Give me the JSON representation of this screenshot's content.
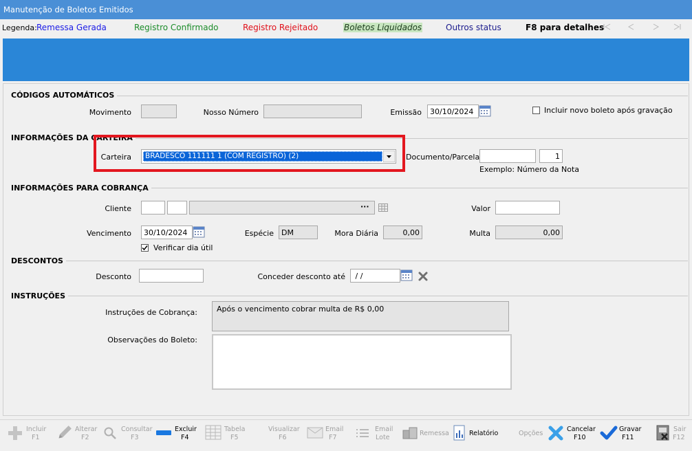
{
  "window": {
    "title": "Manutenção de Boletos Emitidos"
  },
  "legend": {
    "label": "Legenda:",
    "items": [
      "Remessa Gerada",
      "Registro Confirmado",
      "Registro Rejeitado",
      "Boletos Liquidados",
      "Outros status"
    ],
    "hint": "F8 para detalhes",
    "colors": {
      "remessa": "#1a1ae6",
      "confirmado": "#1c8c2a",
      "rejeitado": "#e0101a",
      "liquidados_bg": "#c8e6c0",
      "outros": "#1a1a8c"
    }
  },
  "sections": {
    "codigos": "CÓDIGOS AUTOMÁTICOS",
    "carteira": "INFORMAÇÕES DA CARTEIRA",
    "cobranca": "INFORMAÇÕES PARA COBRANÇA",
    "descontos": "DESCONTOS",
    "instrucoes": "INSTRUÇÕES"
  },
  "fields": {
    "movimento": {
      "label": "Movimento",
      "value": ""
    },
    "nosso_numero": {
      "label": "Nosso Número",
      "value": ""
    },
    "emissao": {
      "label": "Emissão",
      "value": "30/10/2024"
    },
    "incluir_novo": {
      "label": "Incluir novo boleto após gravação",
      "checked": false
    },
    "carteira": {
      "label": "Carteira",
      "value": "BRADESCO  111111 1 (COM REGISTRO)  (2)"
    },
    "documento": {
      "label": "Documento/Parcela",
      "value": "",
      "parcela": "1",
      "hint": "Exemplo: Número da Nota"
    },
    "cliente": {
      "label": "Cliente",
      "code1": "",
      "code2": "",
      "name": "",
      "dots": "···"
    },
    "valor": {
      "label": "Valor",
      "value": ""
    },
    "vencimento": {
      "label": "Vencimento",
      "value": "30/10/2024"
    },
    "especie": {
      "label": "Espécie",
      "value": "DM"
    },
    "mora": {
      "label": "Mora Diária",
      "value": "0,00"
    },
    "multa": {
      "label": "Multa",
      "value": "0,00"
    },
    "verificar": {
      "label": "Verificar dia útil",
      "checked": true
    },
    "desconto": {
      "label": "Desconto",
      "value": ""
    },
    "conceder": {
      "label": "Conceder desconto até",
      "value": " / /"
    },
    "instr_cobranca": {
      "label": "Instruções de Cobrança:",
      "value": "Após o vencimento cobrar multa de R$ 0,00"
    },
    "observacoes": {
      "label": "Observações do Boleto:",
      "value": ""
    }
  },
  "toolbar": {
    "incluir": {
      "label": "Incluir",
      "key": "F1"
    },
    "alterar": {
      "label": "Alterar",
      "key": "F2"
    },
    "consultar": {
      "label": "Consultar",
      "key": "F3"
    },
    "excluir": {
      "label": "Excluir",
      "key": "F4"
    },
    "tabela": {
      "label": "Tabela",
      "key": "F5"
    },
    "visualizar": {
      "label": "Visualizar",
      "key": "F6"
    },
    "email": {
      "label": "Email",
      "key": "F7"
    },
    "email_lote": {
      "label": "Email",
      "key": "Lote"
    },
    "remessa": {
      "label": "Remessa"
    },
    "relatorio": {
      "label": "Relatório"
    },
    "opcoes": {
      "label": "Opções"
    },
    "cancelar": {
      "label": "Cancelar",
      "key": "F10"
    },
    "gravar": {
      "label": "Gravar",
      "key": "F11"
    },
    "sair": {
      "label": "Sair",
      "key": "F12"
    }
  }
}
